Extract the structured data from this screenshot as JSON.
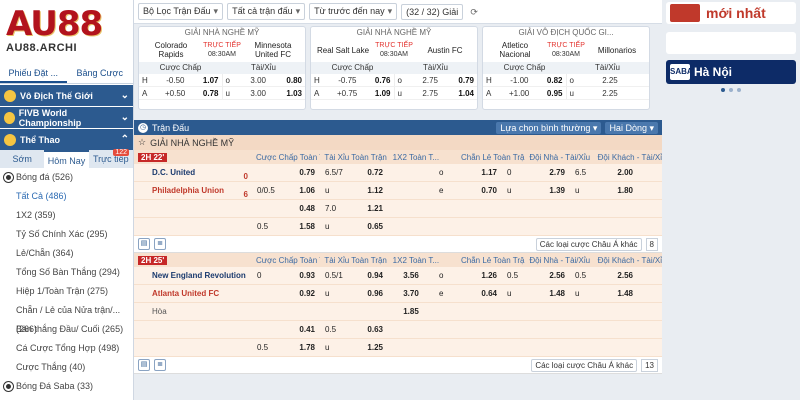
{
  "left": {
    "logo": {
      "brand": "AU88",
      "domain": "AU88.ARCHI"
    },
    "tabs": [
      "Phiếu Đặt ...",
      "Bảng Cược"
    ],
    "sections": [
      {
        "label": "Vô Địch Thế Giới"
      },
      {
        "label": "FIVB World Championship"
      },
      {
        "label": "Thể Thao"
      }
    ],
    "sport_tabs": [
      "Sớm",
      "Hôm Nay",
      "Trực tiếp"
    ],
    "live_badge": "122",
    "items": [
      {
        "label": "Bóng đá (526)",
        "ball": true
      },
      {
        "label": "Tất Cả (486)",
        "link": true
      },
      {
        "label": "1X2 (359)"
      },
      {
        "label": "Tỷ Số Chính Xác (295)"
      },
      {
        "label": "Lẻ/Chẵn (364)"
      },
      {
        "label": "Tổng Số Bàn Thắng (294)"
      },
      {
        "label": "Hiệp 1/Toàn Trận (275)"
      },
      {
        "label": "Chẵn / Lẻ của Nửa trận/... (266)"
      },
      {
        "label": "Bàn thắng Đầu/ Cuối (265)"
      },
      {
        "label": "Cá Cược Tổng Hợp (498)"
      },
      {
        "label": "Cược Thắng (40)"
      },
      {
        "label": "Bóng Đá Saba (33)",
        "ball": true
      }
    ]
  },
  "topbar": {
    "filter": "Bộ Lọc Trận Đấu",
    "matches": "Tất cả trận đấu",
    "time": "Từ trước đến nay",
    "count": "(32 / 32) Giải"
  },
  "cards": [
    {
      "league": "GIẢI NHÀ NGHỀ MỸ",
      "home": "Colorado Rapids",
      "away": "Minnesota United FC",
      "status": "TRỰC TIẾP",
      "time": "08:30AM",
      "hcap_label": "Cược Chấp",
      "ou_label": "Tài/Xỉu",
      "rows": [
        [
          "H",
          "-0.50",
          "1.07",
          "o",
          "3.00",
          "0.80"
        ],
        [
          "A",
          "+0.50",
          "0.78",
          "u",
          "3.00",
          "1.03"
        ]
      ]
    },
    {
      "league": "GIẢI NHÀ NGHỀ MỸ",
      "home": "Real Salt Lake",
      "away": "Austin FC",
      "status": "TRỰC TIẾP",
      "time": "08:30AM",
      "hcap_label": "Cược Chấp",
      "ou_label": "Tài/Xỉu",
      "rows": [
        [
          "H",
          "-0.75",
          "0.76",
          "o",
          "2.75",
          "0.79"
        ],
        [
          "A",
          "+0.75",
          "1.09",
          "u",
          "2.75",
          "1.04"
        ]
      ]
    },
    {
      "league": "GIẢI VÔ ĐỊCH QUỐC GI...",
      "home": "Atletico Nacional",
      "away": "Millonarios",
      "status": "TRỰC TIẾP",
      "time": "08:30AM",
      "hcap_label": "Cược Chấp",
      "ou_label": "Tài/Xỉu",
      "rows": [
        [
          "H",
          "-1.00",
          "0.82",
          "o",
          "2.25",
          ""
        ],
        [
          "A",
          "+1.00",
          "0.95",
          "u",
          "2.25",
          ""
        ]
      ]
    }
  ],
  "bluebar": {
    "title": "Trận Đấu",
    "sort": "Lựa chọn bình thường",
    "view": "Hai Dòng"
  },
  "league": "GIẢI NHÀ NGHỀ MỸ",
  "headers": [
    "Cược Chấp Toàn Tr...",
    "Tài Xỉu Toàn Trận",
    "1X2 Toàn T...",
    "Chẵn Lẻ Toàn Trận",
    "Đội Nhà - Tài/Xỉu",
    "Đội Khách - Tài/Xỉu"
  ],
  "matches": [
    {
      "time": "2H 22'",
      "home": "D.C. United",
      "away": "Philadelphia Union",
      "home_score": "0",
      "away_score": "6",
      "rows": [
        [
          "",
          "0.79",
          "6.5/7",
          "0.72",
          "",
          "o",
          "1.17",
          "0",
          "2.79",
          "6.5",
          "2.00"
        ],
        [
          "0/0.5",
          "1.06",
          "u",
          "1.12",
          "",
          "e",
          "0.70",
          "u",
          "1.39",
          "u",
          "1.80"
        ],
        [
          "",
          "0.48",
          "7.0",
          "1.21",
          "",
          "",
          "",
          "",
          "",
          "",
          ""
        ],
        [
          "0.5",
          "1.58",
          "u",
          "0.65",
          "",
          "",
          "",
          "",
          "",
          "",
          ""
        ]
      ],
      "more": "Các loại cược Châu Á khác",
      "count": "8"
    },
    {
      "time": "2H 25'",
      "home": "New England Revolution",
      "away": "Atlanta United FC",
      "home_score": "",
      "away_score": "",
      "draw": "Hòa",
      "rows": [
        [
          "0",
          "0.93",
          "0.5/1",
          "0.94",
          "3.56",
          "o",
          "1.26",
          "0.5",
          "2.56",
          "0.5",
          "2.56"
        ],
        [
          "",
          "0.92",
          "u",
          "0.96",
          "3.70",
          "e",
          "0.64",
          "u",
          "1.48",
          "u",
          "1.48"
        ],
        [
          "",
          "",
          "",
          "",
          "1.85",
          "",
          "",
          "",
          "",
          "",
          ""
        ],
        [
          "",
          "0.41",
          "0.5",
          "0.63",
          "",
          "",
          "",
          "",
          "",
          "",
          ""
        ],
        [
          "0.5",
          "1.78",
          "u",
          "1.25",
          "",
          "",
          "",
          "",
          "",
          "",
          ""
        ]
      ],
      "more": "Các loại cược Châu Á khác",
      "count": "13"
    }
  ],
  "right": {
    "banner1": "mới nhất",
    "banner3_logo": "SABA",
    "banner3_text": "Hà Nội"
  }
}
